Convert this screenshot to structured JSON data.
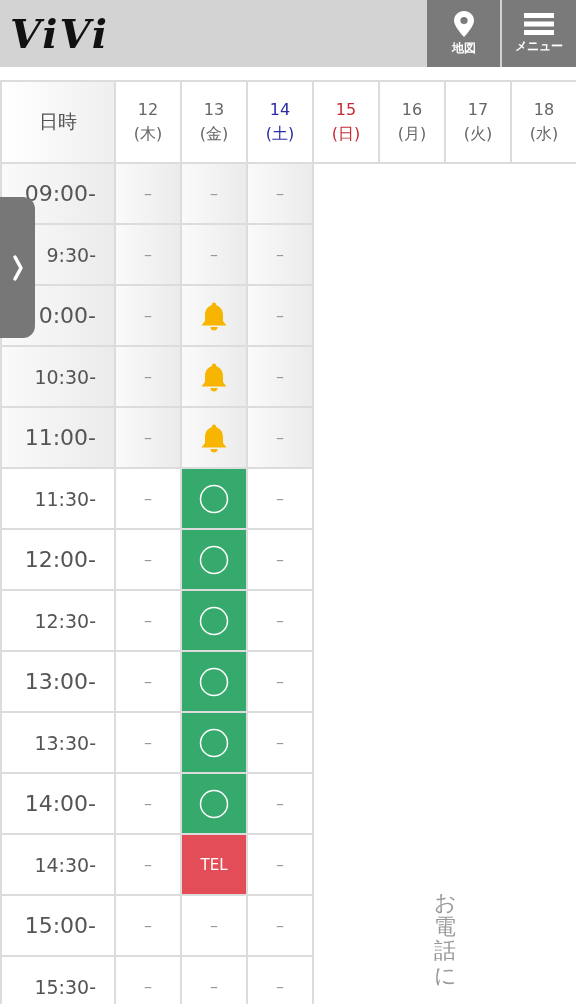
{
  "header": {
    "logo": "ViVi",
    "buttons": [
      {
        "kind": "map",
        "label": "地図"
      },
      {
        "kind": "menu",
        "label": "メニュー"
      }
    ]
  },
  "table": {
    "corner": "日時",
    "days": [
      {
        "date": "12",
        "weekday": "(木)",
        "color": "#666666"
      },
      {
        "date": "13",
        "weekday": "(金)",
        "color": "#666666"
      },
      {
        "date": "14",
        "weekday": "(土)",
        "color": "#2b2ba6"
      },
      {
        "date": "15",
        "weekday": "(日)",
        "color": "#c62a33"
      },
      {
        "date": "16",
        "weekday": "(月)",
        "color": "#666666"
      },
      {
        "date": "17",
        "weekday": "(火)",
        "color": "#666666"
      },
      {
        "date": "18",
        "weekday": "(水)",
        "color": "#666666"
      }
    ],
    "rows": [
      {
        "time": "09:00-",
        "shaded": true,
        "slots": [
          {
            "kind": "dash",
            "text": "–"
          },
          {
            "kind": "dash",
            "text": "–"
          },
          {
            "kind": "dash",
            "text": "–"
          }
        ]
      },
      {
        "time": "9:30-",
        "shaded": true,
        "slots": [
          {
            "kind": "dash",
            "text": "–"
          },
          {
            "kind": "dash",
            "text": "–"
          },
          {
            "kind": "dash",
            "text": "–"
          }
        ]
      },
      {
        "time": "0:00-",
        "shaded": true,
        "slots": [
          {
            "kind": "dash",
            "text": "–"
          },
          {
            "kind": "bell"
          },
          {
            "kind": "dash",
            "text": "–"
          }
        ]
      },
      {
        "time": "10:30-",
        "shaded": true,
        "slots": [
          {
            "kind": "dash",
            "text": "–"
          },
          {
            "kind": "bell"
          },
          {
            "kind": "dash",
            "text": "–"
          }
        ]
      },
      {
        "time": "11:00-",
        "shaded": true,
        "slots": [
          {
            "kind": "dash",
            "text": "–"
          },
          {
            "kind": "bell"
          },
          {
            "kind": "dash",
            "text": "–"
          }
        ]
      },
      {
        "time": "11:30-",
        "shaded": false,
        "slots": [
          {
            "kind": "dash",
            "text": "–"
          },
          {
            "kind": "open"
          },
          {
            "kind": "dash",
            "text": "–"
          }
        ]
      },
      {
        "time": "12:00-",
        "shaded": false,
        "slots": [
          {
            "kind": "dash",
            "text": "–"
          },
          {
            "kind": "open"
          },
          {
            "kind": "dash",
            "text": "–"
          }
        ]
      },
      {
        "time": "12:30-",
        "shaded": false,
        "slots": [
          {
            "kind": "dash",
            "text": "–"
          },
          {
            "kind": "open"
          },
          {
            "kind": "dash",
            "text": "–"
          }
        ]
      },
      {
        "time": "13:00-",
        "shaded": false,
        "slots": [
          {
            "kind": "dash",
            "text": "–"
          },
          {
            "kind": "open"
          },
          {
            "kind": "dash",
            "text": "–"
          }
        ]
      },
      {
        "time": "13:30-",
        "shaded": false,
        "slots": [
          {
            "kind": "dash",
            "text": "–"
          },
          {
            "kind": "open"
          },
          {
            "kind": "dash",
            "text": "–"
          }
        ]
      },
      {
        "time": "14:00-",
        "shaded": false,
        "slots": [
          {
            "kind": "dash",
            "text": "–"
          },
          {
            "kind": "open"
          },
          {
            "kind": "dash",
            "text": "–"
          }
        ]
      },
      {
        "time": "14:30-",
        "shaded": false,
        "slots": [
          {
            "kind": "dash",
            "text": "–"
          },
          {
            "kind": "tel",
            "text": "TEL"
          },
          {
            "kind": "dash",
            "text": "–"
          }
        ]
      },
      {
        "time": "15:00-",
        "shaded": false,
        "slots": [
          {
            "kind": "dash",
            "text": "–"
          },
          {
            "kind": "dash",
            "text": "–"
          },
          {
            "kind": "dash",
            "text": "–"
          }
        ]
      },
      {
        "time": "15:30-",
        "shaded": false,
        "slots": [
          {
            "kind": "dash",
            "text": "–"
          },
          {
            "kind": "dash",
            "text": "–"
          },
          {
            "kind": "dash",
            "text": "–"
          }
        ]
      }
    ],
    "closed_note": "お電話に"
  }
}
